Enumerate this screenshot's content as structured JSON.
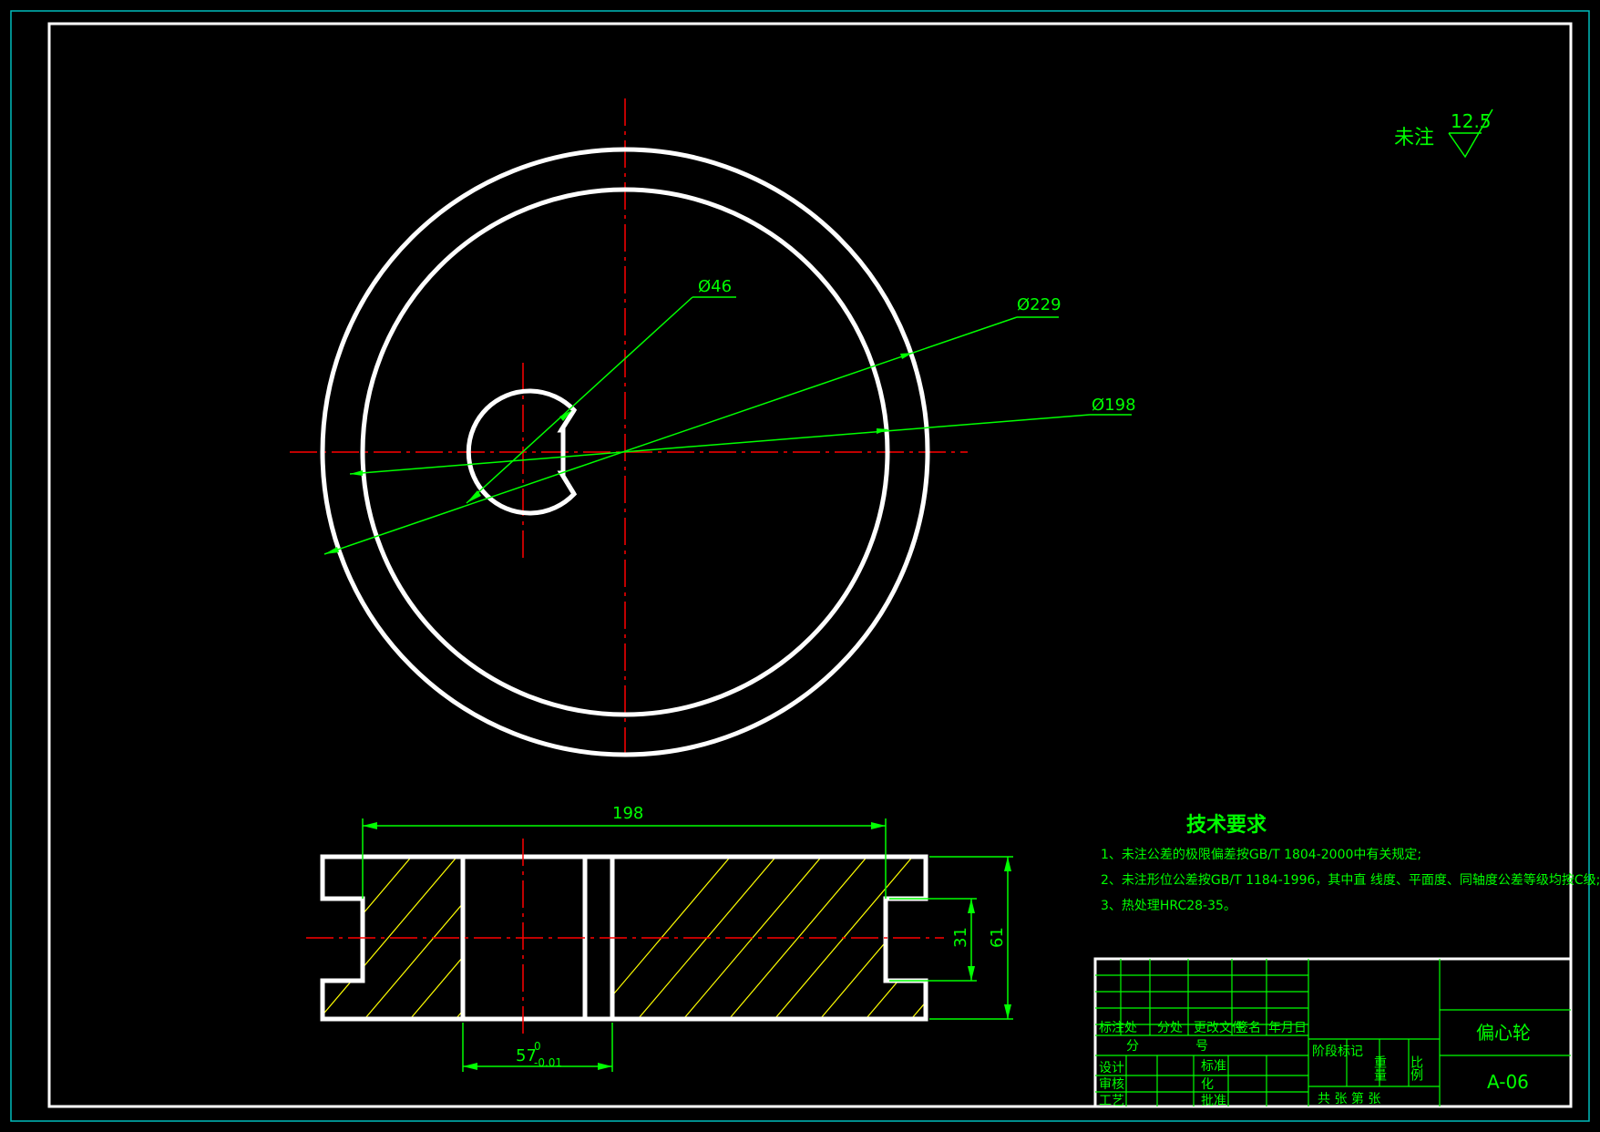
{
  "colors": {
    "background": "#000000",
    "outline": "#ffffff",
    "dimension": "#00ff00",
    "centerline": "#ff0000",
    "hatch": "#ffff00",
    "frame_outer": "#00bcbc"
  },
  "surface_finish": {
    "prefix": "未注",
    "value": "12.5"
  },
  "top_view_dims": {
    "hole": "Ø46",
    "outer": "Ø229",
    "inner": "Ø198"
  },
  "section_dims": {
    "width": "198",
    "height_outer": "61",
    "height_inner": "31",
    "hole_width": "57",
    "hole_tol_upper": "0",
    "hole_tol_lower": "-0.01"
  },
  "tech_requirements": {
    "title": "技术要求",
    "items": [
      "1、未注公差的极限偏差按GB/T 1804-2000中有关规定;",
      "2、未注形位公差按GB/T 1184-1996，其中直 线度、平面度、同轴度公差等级均按C级;",
      "3、热处理HRC28-35。"
    ]
  },
  "title_block": {
    "part_name": "偏心轮",
    "drawing_no": "A-06",
    "rev_header": [
      "标注处",
      "分处",
      "更改文件",
      "签名",
      "年月日"
    ],
    "division_label": "分",
    "number_label": "号",
    "stage_label": "阶段标记",
    "weight_label": "重量",
    "scale_label": "比例",
    "design": "设计",
    "check": "审核",
    "process": "工艺",
    "standard": "标准",
    "standardize": "化",
    "approve": "批准",
    "sheets_label": "共  张  第  张"
  }
}
